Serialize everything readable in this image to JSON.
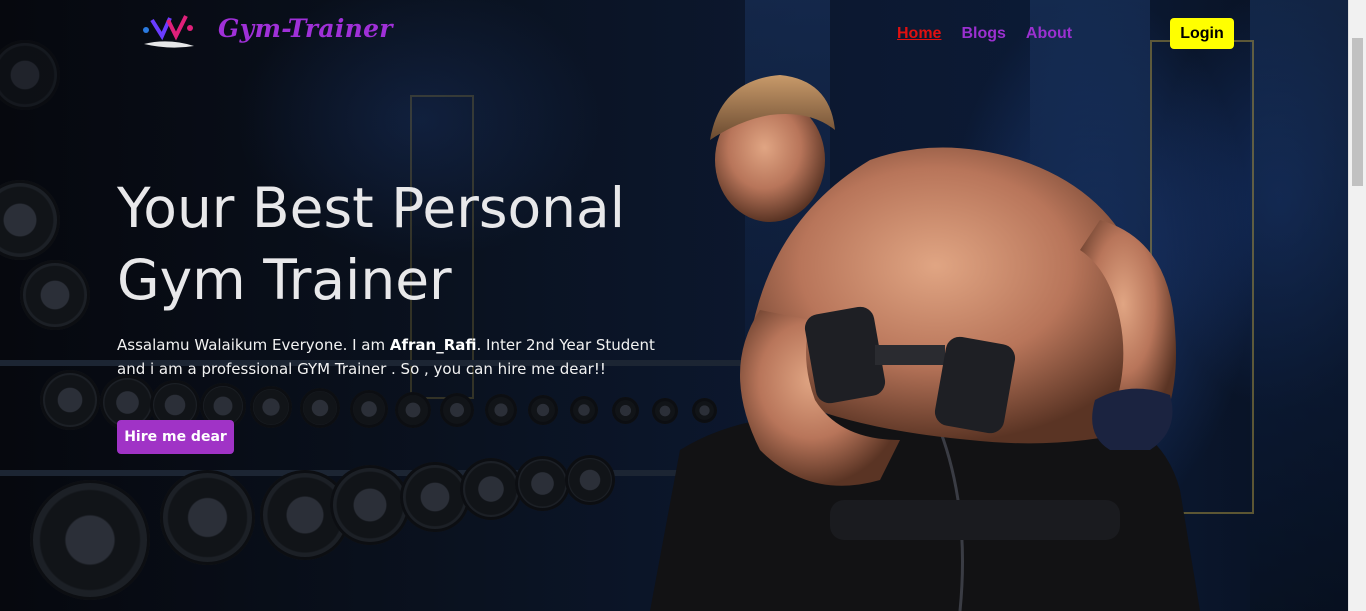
{
  "header": {
    "brand": "Gym-Trainer",
    "logo_icon": "dumbbell-brush-logo",
    "nav": [
      {
        "label": "Home",
        "active": true
      },
      {
        "label": "Blogs",
        "active": false
      },
      {
        "label": "About",
        "active": false
      }
    ],
    "login_label": "Login"
  },
  "hero": {
    "title_line1": "Your Best Personal",
    "title_line2": "Gym Trainer",
    "text_part1": "Assalamu Walaikum Everyone. I am ",
    "text_name": "Afran_Rafi",
    "text_part2": ". Inter 2nd Year Student and i am a professional GYM Trainer . So , you can hire me dear!!",
    "hire_label": "Hire me dear"
  },
  "colors": {
    "brand": "#a030d8",
    "nav_link": "#9b30d0",
    "nav_active": "#e01010",
    "login_bg": "#ffff00",
    "hire_bg": "#a033c6"
  }
}
